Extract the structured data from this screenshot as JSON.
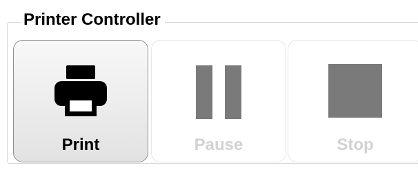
{
  "panel": {
    "title": "Printer Controller"
  },
  "buttons": {
    "print": {
      "label": "Print",
      "icon": "printer-icon",
      "enabled": true
    },
    "pause": {
      "label": "Pause",
      "icon": "pause-icon",
      "enabled": false
    },
    "stop": {
      "label": "Stop",
      "icon": "stop-icon",
      "enabled": false
    }
  },
  "colors": {
    "enabled_text": "#000000",
    "disabled_text": "#d2d2d2",
    "disabled_icon": "#7a7a7a"
  }
}
